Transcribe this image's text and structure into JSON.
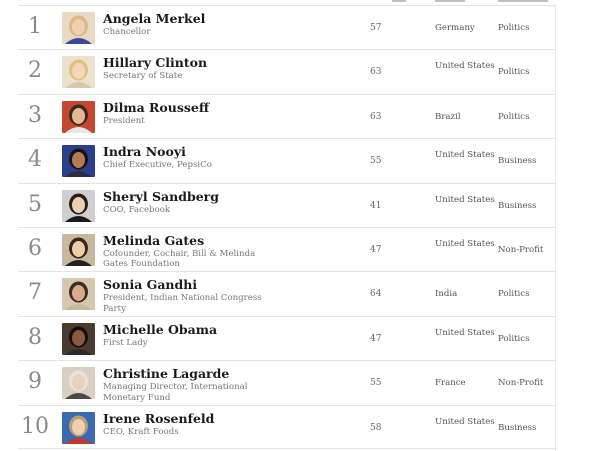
{
  "colors": {
    "divider": "#e4e4e4",
    "rank": "#8a8a8a",
    "name": "#1a1a1a",
    "subtitle": "#777777"
  },
  "rows": [
    {
      "rank": "1",
      "name": "Angela Merkel",
      "title": "Chancellor",
      "age": "57",
      "country": "Germany",
      "category": "Politics",
      "photo": {
        "bg": "#e8d9c0",
        "hair": "#d9b98a",
        "skin": "#f0cfb0",
        "top": "#3a4a9a"
      }
    },
    {
      "rank": "2",
      "name": "Hillary Clinton",
      "title": "Secretary of State",
      "age": "63",
      "country": "United States",
      "category": "Politics",
      "photo": {
        "bg": "#eae1cf",
        "hair": "#e0c27a",
        "skin": "#f3d6bb",
        "top": "#d8c8a8"
      }
    },
    {
      "rank": "3",
      "name": "Dilma Rousseff",
      "title": "President",
      "age": "63",
      "country": "Brazil",
      "category": "Politics",
      "photo": {
        "bg": "#c4472e",
        "hair": "#3a2a20",
        "skin": "#e3b894",
        "top": "#e7e7e7"
      }
    },
    {
      "rank": "4",
      "name": "Indra Nooyi",
      "title": "Chief Executive, PepsiCo",
      "age": "55",
      "country": "United States",
      "category": "Business",
      "photo": {
        "bg": "#2a3f8c",
        "hair": "#1a1410",
        "skin": "#b27a55",
        "top": "#2b2b44"
      }
    },
    {
      "rank": "5",
      "name": "Sheryl Sandberg",
      "title": "COO, Facebook",
      "age": "41",
      "country": "United States",
      "category": "Business",
      "photo": {
        "bg": "#cfcfcf",
        "hair": "#2a1f18",
        "skin": "#efcfb2",
        "top": "#1b1b1b"
      }
    },
    {
      "rank": "6",
      "name": "Melinda Gates",
      "title": "Cofounder, Cochair, Bill & Melinda Gates Foundation",
      "age": "47",
      "country": "United States",
      "category": "Non-Profit",
      "photo": {
        "bg": "#c8b8a0",
        "hair": "#3a281a",
        "skin": "#efccaa",
        "top": "#222222"
      }
    },
    {
      "rank": "7",
      "name": "Sonia Gandhi",
      "title": "President, Indian National Congress Party",
      "age": "64",
      "country": "India",
      "category": "Politics",
      "photo": {
        "bg": "#d6c7b0",
        "hair": "#3a2d22",
        "skin": "#d8a98a",
        "top": "#c9b9a0"
      }
    },
    {
      "rank": "8",
      "name": "Michelle Obama",
      "title": "First Lady",
      "age": "47",
      "country": "United States",
      "category": "Politics",
      "photo": {
        "bg": "#4a3a30",
        "hair": "#150f0c",
        "skin": "#8a5a3e",
        "top": "#2a2a2a"
      }
    },
    {
      "rank": "9",
      "name": "Christine Lagarde",
      "title": "Managing Director, International Monetary Fund",
      "age": "55",
      "country": "France",
      "category": "Non-Profit",
      "photo": {
        "bg": "#d8d0c4",
        "hair": "#e8e4dc",
        "skin": "#ecd0b8",
        "top": "#4a4a4a"
      }
    },
    {
      "rank": "10",
      "name": "Irene Rosenfeld",
      "title": "CEO, Kraft Foods",
      "age": "58",
      "country": "United States",
      "category": "Business",
      "photo": {
        "bg": "#3a6ab0",
        "hair": "#b8a070",
        "skin": "#f0cfb0",
        "top": "#c0392b"
      }
    }
  ]
}
